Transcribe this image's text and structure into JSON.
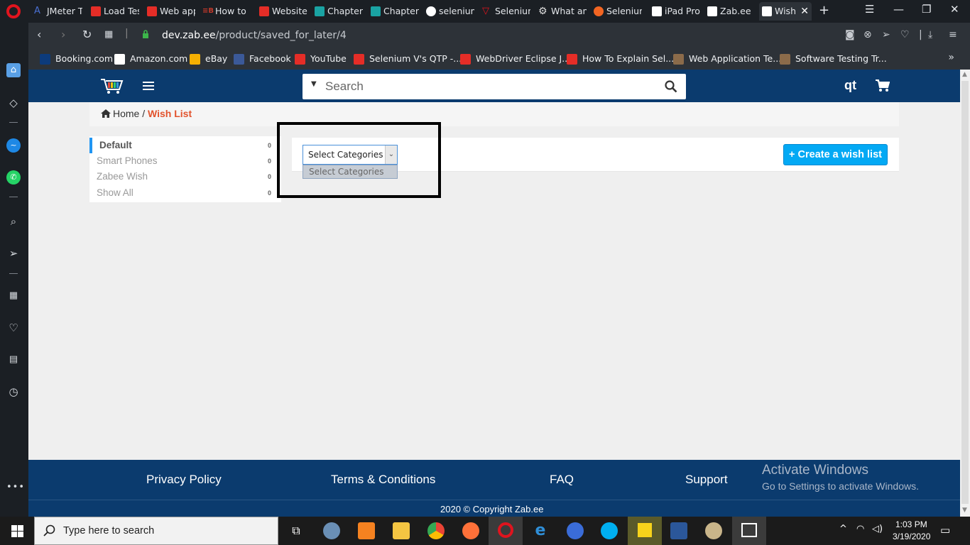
{
  "browser": {
    "tabs": [
      {
        "label": "JMeter T",
        "icon": "jmeter-icon",
        "color": "#4a6fd1"
      },
      {
        "label": "Load Tes",
        "icon": "youtube-icon",
        "color": "#e52d27"
      },
      {
        "label": "Web app",
        "icon": "youtube-icon",
        "color": "#e52d27"
      },
      {
        "label": "How to",
        "icon": "b-icon",
        "color": "#c0392b"
      },
      {
        "label": "Website",
        "icon": "youtube-icon",
        "color": "#e52d27"
      },
      {
        "label": "Chapter",
        "icon": "t4u-icon",
        "color": "#1aa3a3"
      },
      {
        "label": "Chapter",
        "icon": "t4u-icon",
        "color": "#1aa3a3"
      },
      {
        "label": "selenium",
        "icon": "google-icon",
        "color": "#ffffff"
      },
      {
        "label": "Selenium",
        "icon": "v-icon",
        "color": "#e5131d"
      },
      {
        "label": "What an",
        "icon": "gear-icon",
        "color": "#dddddd"
      },
      {
        "label": "Selenium",
        "icon": "b-circle-icon",
        "color": "#f26522"
      },
      {
        "label": "iPad Pro",
        "icon": "zabee-icon",
        "color": "#ffffff"
      },
      {
        "label": "Zab.ee",
        "icon": "zabee-icon",
        "color": "#ffffff"
      },
      {
        "label": "Wish",
        "icon": "zabee-icon",
        "color": "#ffffff",
        "active": true
      }
    ],
    "url_host": "dev.zab.ee",
    "url_path": "/product/saved_for_later/4",
    "bookmarks": [
      {
        "label": "Booking.com",
        "icon": "booking-icon",
        "color": "#0c3b7c"
      },
      {
        "label": "Amazon.com",
        "icon": "amazon-icon",
        "color": "#ffffff"
      },
      {
        "label": "eBay",
        "icon": "ebay-icon",
        "color": "#f5af02"
      },
      {
        "label": "Facebook",
        "icon": "facebook-icon",
        "color": "#3b5998"
      },
      {
        "label": "YouTube",
        "icon": "youtube-icon",
        "color": "#e52d27"
      },
      {
        "label": "Selenium V's QTP -...",
        "icon": "youtube-icon",
        "color": "#e52d27"
      },
      {
        "label": "WebDriver Eclipse J...",
        "icon": "youtube-icon",
        "color": "#e52d27"
      },
      {
        "label": "How To Explain Sel...",
        "icon": "youtube-icon",
        "color": "#e52d27"
      },
      {
        "label": "Web Application Te...",
        "icon": "box-icon",
        "color": "#8b6b4a"
      },
      {
        "label": "Software Testing Tr...",
        "icon": "box-icon",
        "color": "#8b6b4a"
      }
    ]
  },
  "site": {
    "search_placeholder": "Search",
    "user": "qt",
    "breadcrumb": {
      "home": "Home",
      "separator": "/",
      "current": "Wish List"
    },
    "wishlists": [
      {
        "label": "Default",
        "count": "0",
        "active": true
      },
      {
        "label": "Smart Phones",
        "count": "0"
      },
      {
        "label": "Zabee Wish",
        "count": "0"
      },
      {
        "label": "Show All",
        "count": "0"
      }
    ],
    "category_select": {
      "selected": "Select Categories",
      "options": [
        "Select Categories"
      ]
    },
    "create_button": "+ Create a wish list",
    "footer_links": [
      "Privacy Policy",
      "Terms & Conditions",
      "FAQ",
      "Support"
    ],
    "copyright": "2020 © Copyright Zab.ee",
    "accent_color": "#03a9f4",
    "brand_color": "#0b3b6e",
    "breadcrumb_color": "#e2532d"
  },
  "os": {
    "activate_title": "Activate Windows",
    "activate_sub": "Go to Settings to activate Windows.",
    "taskbar_search": "Type here to search",
    "time": "1:03 PM",
    "date": "3/19/2020"
  }
}
